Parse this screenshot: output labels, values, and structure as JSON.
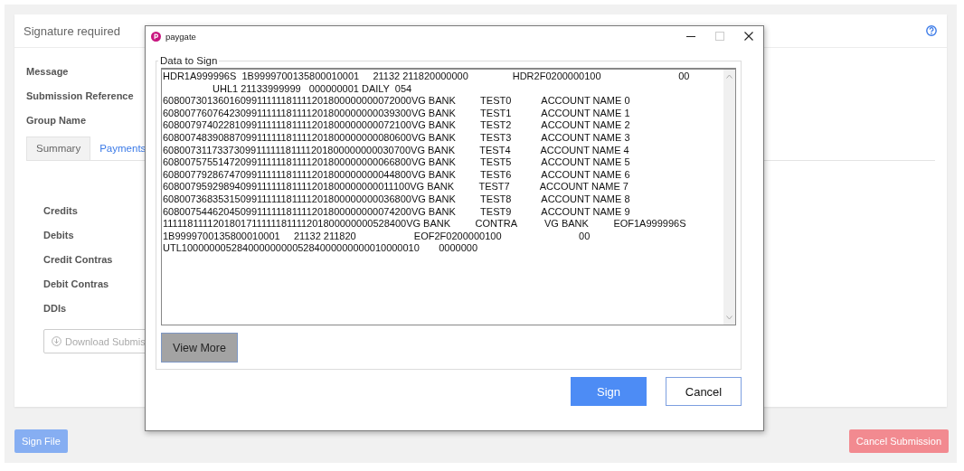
{
  "page": {
    "title": "Signature required",
    "fields": [
      "Message",
      "Submission Reference",
      "Group Name"
    ],
    "tabs": [
      {
        "label": "Summary",
        "selected": true
      },
      {
        "label": "Payments",
        "selected": false
      }
    ],
    "summary_rows": [
      "Credits",
      "Debits",
      "Credit Contras",
      "Debit Contras",
      "DDIs"
    ],
    "download_button": "Download Submis",
    "sign_file_button": "Sign File",
    "cancel_submission_button": "Cancel Submission"
  },
  "dialog": {
    "title": "paygate",
    "group_label": "Data to Sign",
    "lines": [
      "HDR1A999996S  1B9999700135800010001     21132 211820000000                HDR2F0200000100                            00",
      "                  UHL1 21133999999   000000001 DAILY  054",
      "6080073013601609911111181111201800000000072000VG BANK         TEST0           ACCOUNT NAME 0",
      "6080077607642309911111181111201800000000039300VG BANK         TEST1           ACCOUNT NAME 1",
      "6080079740228109911111181111201800000000072100VG BANK         TEST2           ACCOUNT NAME 2",
      "6080074839088709911111181111201800000000080600VG BANK         TEST3           ACCOUNT NAME 3",
      "6080073117337309911111181111201800000000030700VG BANK         TEST4           ACCOUNT NAME 4",
      "6080075755147209911111181111201800000000066800VG BANK         TEST5           ACCOUNT NAME 5",
      "6080077928674709911111181111201800000000044800VG BANK         TEST6           ACCOUNT NAME 6",
      "6080079592989409911111181111201800000000011100VG BANK         TEST7           ACCOUNT NAME 7",
      "6080073683531509911111181111201800000000036800VG BANK         TEST8           ACCOUNT NAME 8",
      "6080075446204509911111181111201800000000074200VG BANK         TEST9           ACCOUNT NAME 9",
      "1111181111201801711111181111201800000000528400VG BANK         CONTRA          VG BANK         EOF1A999996S",
      "1B9999700135800010001     21132 211820                     EOF2F0200000100                            00",
      "UTL1000000052840000000005284000000000010000010       0000000"
    ],
    "view_more_button": "View More",
    "buttons": [
      {
        "label": "Sign",
        "kind": "primary"
      },
      {
        "label": "Cancel",
        "kind": "secondary"
      }
    ]
  }
}
